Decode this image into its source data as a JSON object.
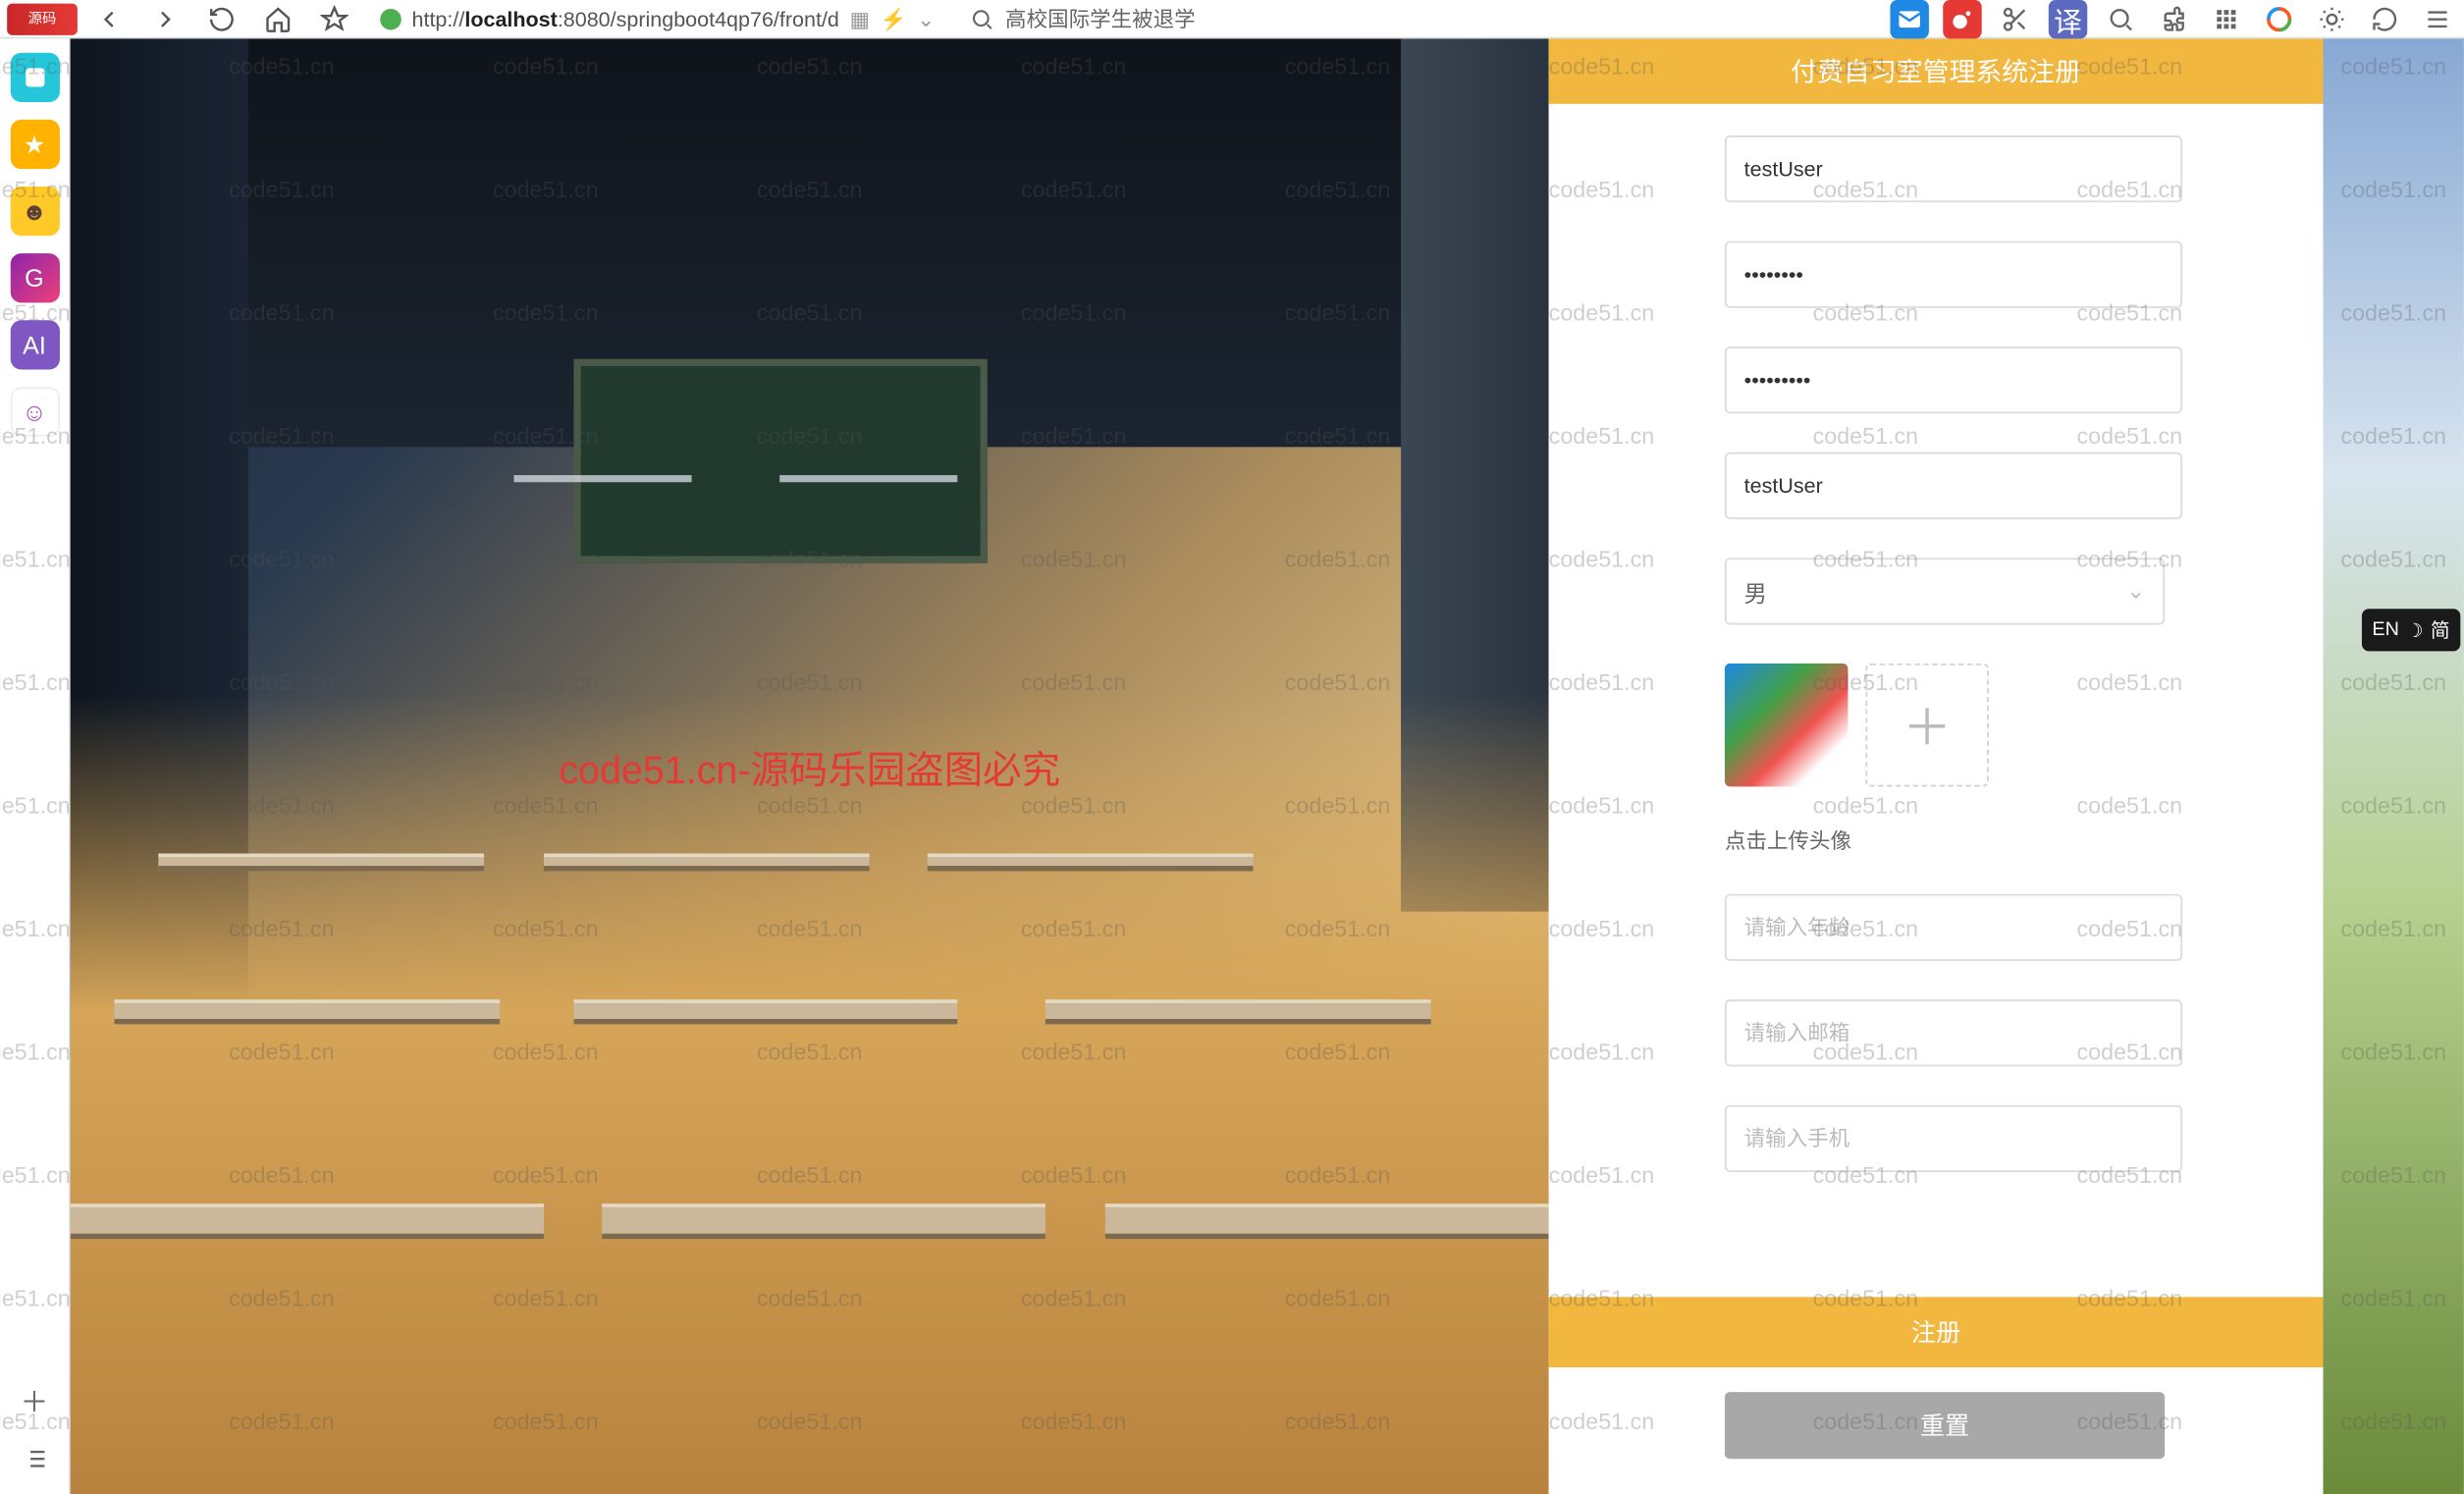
{
  "chrome": {
    "tab_label": "源码",
    "url_host": "localhost",
    "url_prefix": "http://",
    "url_rest": ":8080/springboot4qp76/front/d",
    "search_text": "高校国际学生被退学"
  },
  "ime": {
    "lang": "EN",
    "mode": "简"
  },
  "watermark": {
    "center": "code51.cn-源码乐园盗图必究",
    "repeat": "code51.cn"
  },
  "panel": {
    "title": "付费自习室管理系统注册",
    "username": "testUser",
    "password": "••••••••",
    "confirm": "•••••••••",
    "nickname": "testUser",
    "gender_selected": "男",
    "avatar_hint": "点击上传头像",
    "age_placeholder": "请输入年龄",
    "email_placeholder": "请输入邮箱",
    "phone_placeholder": "请输入手机",
    "submit": "注册",
    "reset": "重置"
  }
}
